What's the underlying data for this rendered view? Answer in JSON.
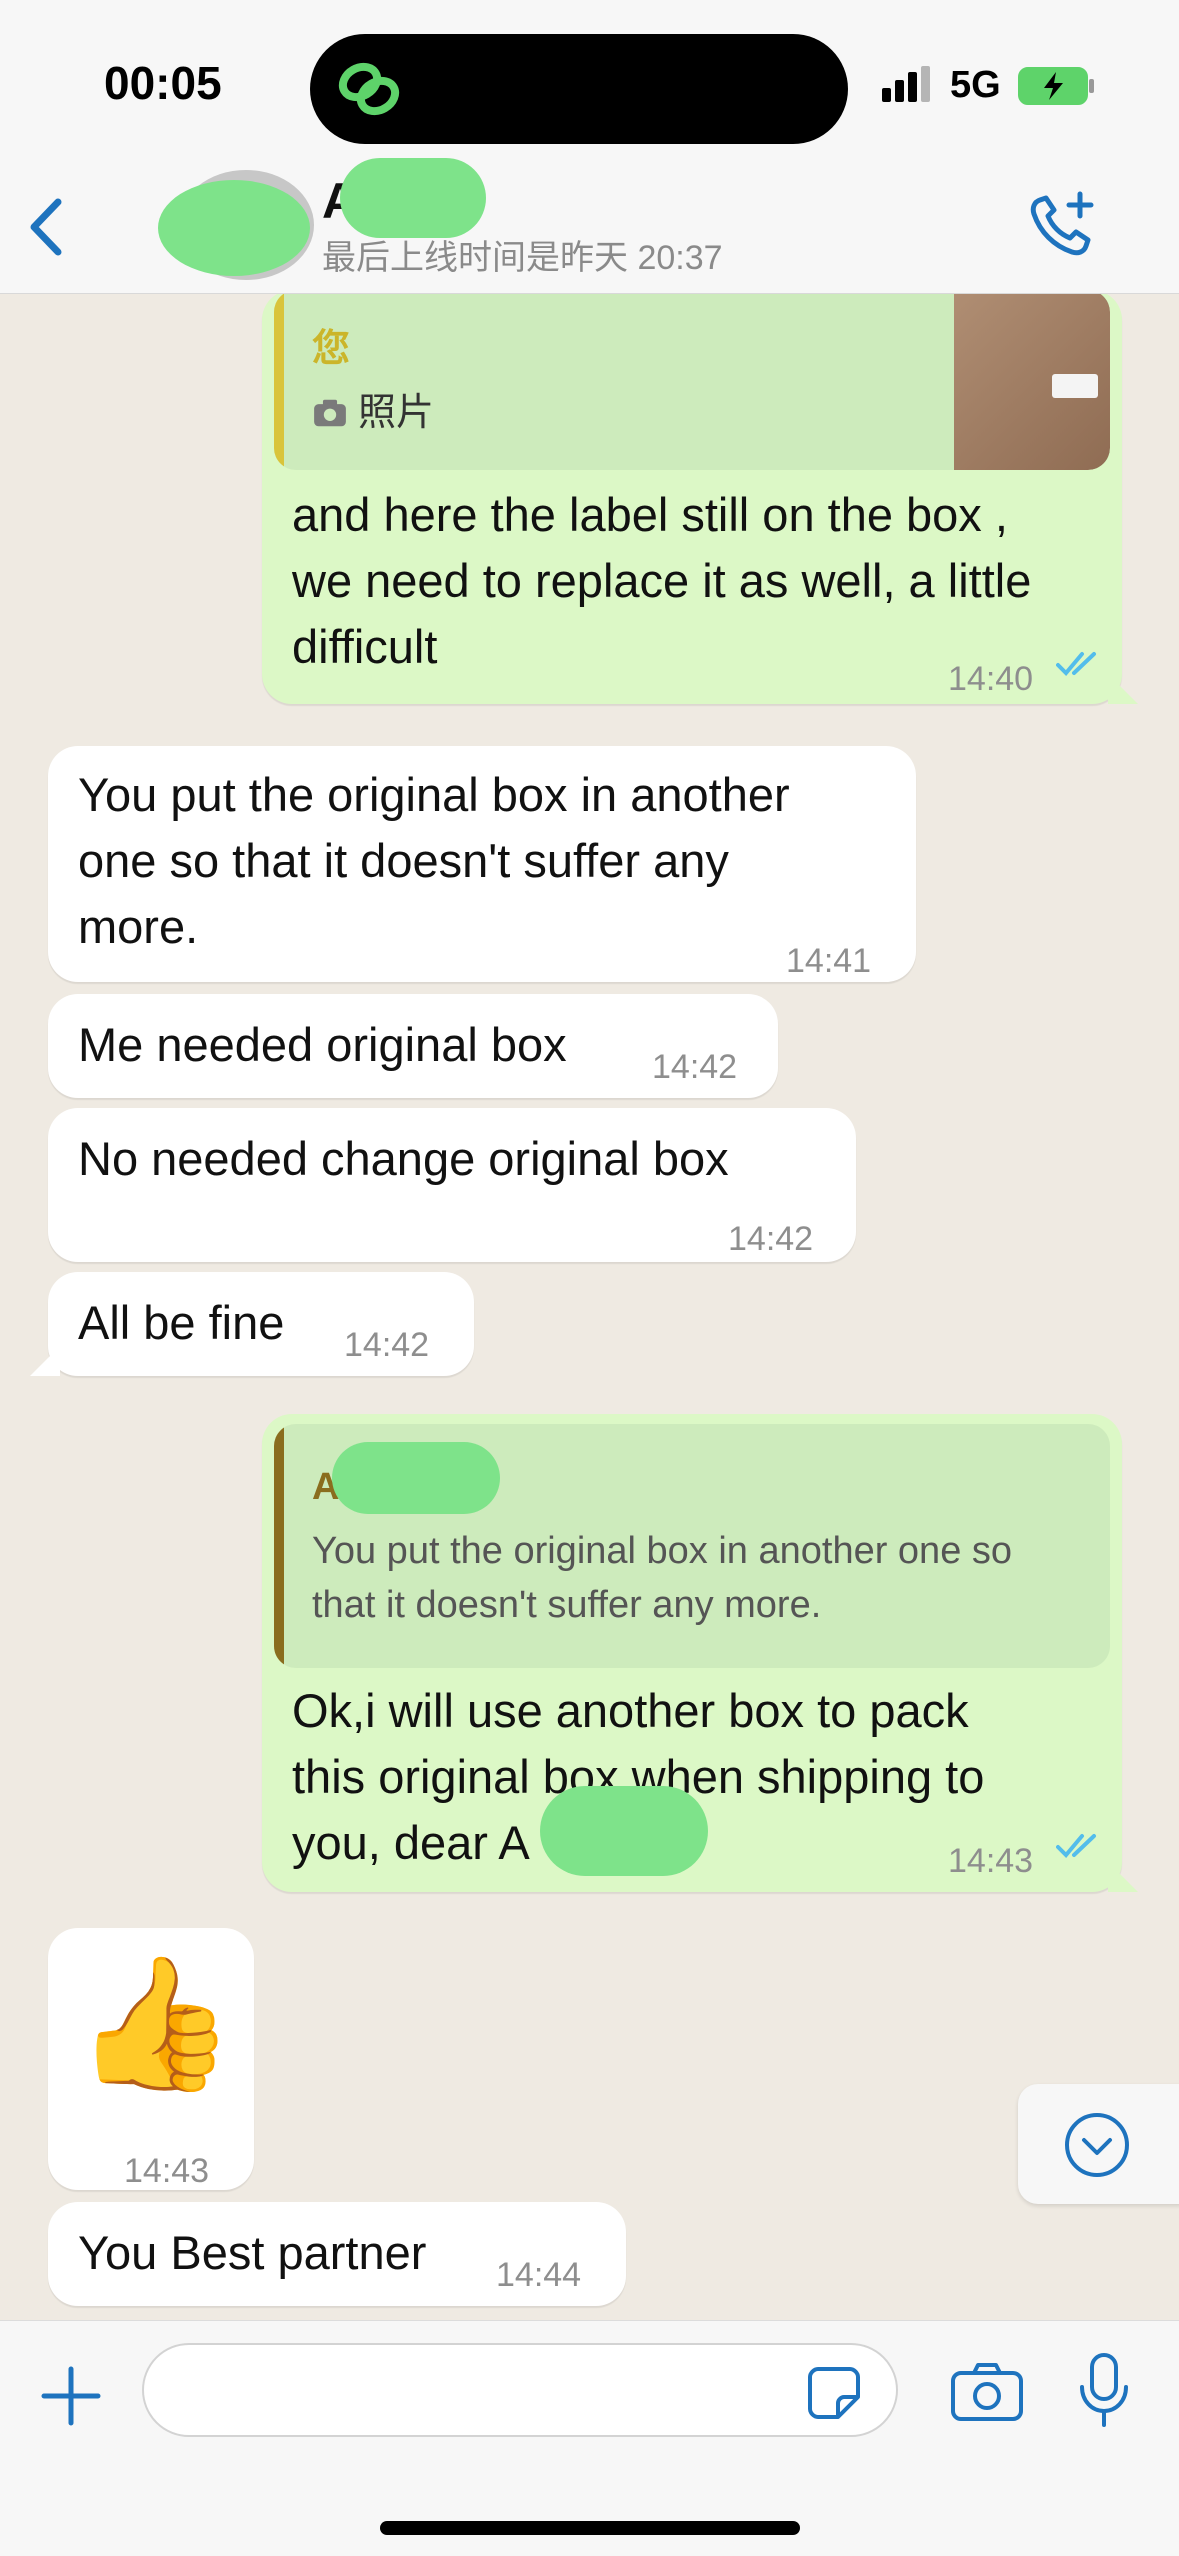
{
  "status_bar": {
    "time": "00:05",
    "network": "5G",
    "battery_charging": true
  },
  "header": {
    "contact_initial": "A",
    "last_seen": "最后上线时间是昨天 20:37"
  },
  "messages": [
    {
      "direction": "out",
      "reply": {
        "author": "您",
        "text": "照片",
        "media": "photo-thumbnail"
      },
      "text_lines": [
        "and here the label still on the box ,",
        "we need to replace it as well, a little",
        "difficult"
      ],
      "time": "14:40",
      "status": "read"
    },
    {
      "direction": "in",
      "text_lines": [
        "You put the original box in another",
        "one so that it doesn't suffer any",
        "more."
      ],
      "time": "14:41"
    },
    {
      "direction": "in",
      "text_lines": [
        "Me needed original box"
      ],
      "time": "14:42"
    },
    {
      "direction": "in",
      "text_lines": [
        "No needed change original box"
      ],
      "time": "14:42"
    },
    {
      "direction": "in",
      "text_lines": [
        "All be fine"
      ],
      "time": "14:42"
    },
    {
      "direction": "out",
      "reply": {
        "author": "A",
        "text_lines": [
          "You put the original box in another one so",
          "that it doesn't suffer any more."
        ]
      },
      "text_lines": [
        "Ok,i will use another box to pack",
        "this original box when shipping to",
        "you, dear A"
      ],
      "time": "14:43",
      "status": "read"
    },
    {
      "direction": "in",
      "emoji": "👍",
      "time": "14:43"
    },
    {
      "direction": "in",
      "text_lines": [
        "You Best partner"
      ],
      "time": "14:44"
    }
  ],
  "composer": {
    "placeholder": ""
  },
  "colors": {
    "accent_blue": "#1e73be",
    "read_tick": "#53bdeb",
    "outgoing_bubble": "#dcf8c6",
    "incoming_bubble": "#ffffff",
    "reply_bar_self": "#d9c43b",
    "reply_bar_contact": "#8a6d1e"
  },
  "icons": {
    "back": "chevron-left-icon",
    "call": "phone-plus-icon",
    "scroll": "chevron-down-circle-icon",
    "attach": "plus-icon",
    "sticker": "sticker-icon",
    "camera": "camera-icon",
    "mic": "microphone-icon"
  }
}
